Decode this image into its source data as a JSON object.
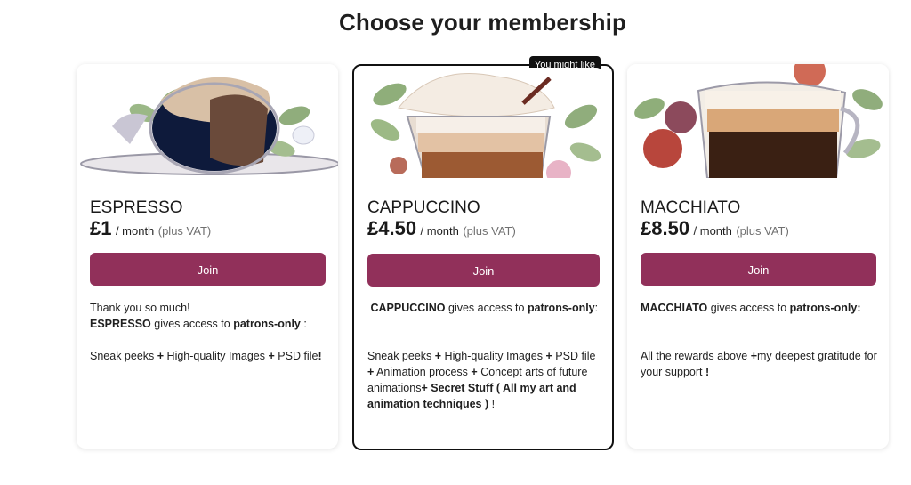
{
  "page": {
    "title": "Choose your membership"
  },
  "tiers": [
    {
      "name": "ESPRESSO",
      "price": "£1",
      "per": "/ month",
      "vat": "(plus VAT)",
      "join_label": "Join",
      "intro": "Thank you so much!",
      "access_name": "ESPRESSO",
      "access_text": " gives access to ",
      "access_target": "patrons-only",
      "access_end": " :",
      "perks": [
        {
          "text": "Sneak peeks ",
          "bold": false
        },
        {
          "text": "+",
          "bold": true
        },
        {
          "text": " High-quality Images ",
          "bold": false
        },
        {
          "text": "+",
          "bold": true
        },
        {
          "text": " PSD file",
          "bold": false
        },
        {
          "text": "!",
          "bold": true
        }
      ]
    },
    {
      "name": "CAPPUCCINO",
      "price": "£4.50",
      "per": "/ month",
      "vat": "(plus VAT)",
      "join_label": "Join",
      "badge": "You might like",
      "access_name": "CAPPUCCINO",
      "access_text": " gives access to ",
      "access_target": "patrons-only",
      "access_end": ":",
      "perks": [
        {
          "text": "Sneak peeks ",
          "bold": false
        },
        {
          "text": "+",
          "bold": true
        },
        {
          "text": " High-quality Images ",
          "bold": false
        },
        {
          "text": "+",
          "bold": true
        },
        {
          "text": " PSD file ",
          "bold": false
        },
        {
          "text": "+",
          "bold": true
        },
        {
          "text": " Animation process ",
          "bold": false
        },
        {
          "text": "+",
          "bold": true
        },
        {
          "text": " Concept arts of future animations",
          "bold": false
        },
        {
          "text": "+ Secret Stuff ( All my art and animation techniques )",
          "bold": true
        },
        {
          "text": " !",
          "bold": false
        }
      ]
    },
    {
      "name": "MACCHIATO",
      "price": "£8.50",
      "per": "/ month",
      "vat": "(plus VAT)",
      "join_label": "Join",
      "access_name": "MACCHIATO",
      "access_text": " gives access to ",
      "access_target": "patrons-only:",
      "access_end": "",
      "perks": [
        {
          "text": "All the rewards above ",
          "bold": false
        },
        {
          "text": "+",
          "bold": true
        },
        {
          "text": "my deepest gratitude for your support ",
          "bold": false
        },
        {
          "text": "!",
          "bold": true
        }
      ]
    }
  ]
}
